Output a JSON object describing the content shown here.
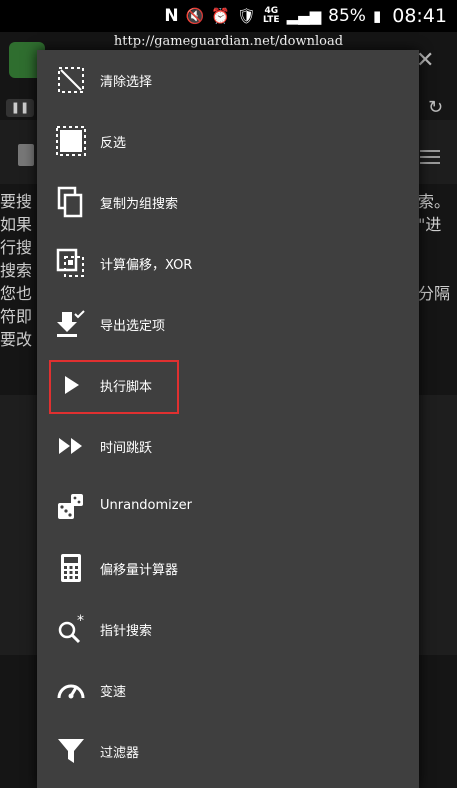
{
  "status_bar": {
    "carrier_icon": "N",
    "network": [
      "4G",
      "LTE"
    ],
    "battery": "85%",
    "time": "08:41"
  },
  "background": {
    "url": "http://gameguardian.net/download",
    "left_text": [
      "要搜",
      "如果",
      "行搜",
      "搜索",
      "您也",
      "符即",
      "要改"
    ],
    "right_text": [
      "索。",
      "\"进",
      "",
      "分隔",
      ""
    ]
  },
  "menu": {
    "items": [
      {
        "label": "清除选择",
        "icon": "clear-selection-icon"
      },
      {
        "label": "反选",
        "icon": "invert-selection-icon"
      },
      {
        "label": "复制为组搜索",
        "icon": "copy-icon"
      },
      {
        "label": "计算偏移，XOR",
        "icon": "offset-calculate-icon"
      },
      {
        "label": "导出选定项",
        "icon": "export-icon"
      },
      {
        "label": "执行脚本",
        "icon": "play-icon"
      },
      {
        "label": "时间跳跃",
        "icon": "fast-forward-icon"
      },
      {
        "label": "Unrandomizer",
        "icon": "dice-icon"
      },
      {
        "label": "偏移量计算器",
        "icon": "calculator-icon"
      },
      {
        "label": "指针搜索",
        "icon": "pointer-search-icon"
      },
      {
        "label": "变速",
        "icon": "speedometer-icon"
      },
      {
        "label": "过滤器",
        "icon": "filter-icon"
      }
    ],
    "highlight_color": "#e03030"
  }
}
